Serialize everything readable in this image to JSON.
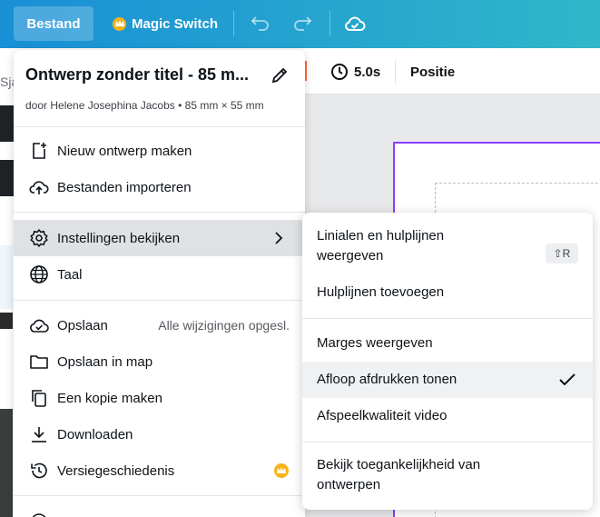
{
  "topbar": {
    "bestand_label": "Bestand",
    "magic_label": "Magic Switch",
    "colors": {
      "gradient_start": "#1a8fd6",
      "gradient_end": "#2fb7c9"
    }
  },
  "toolbar": {
    "timer_label": "5.0s",
    "positie_label": "Positie",
    "search_peek": "Sja"
  },
  "menu": {
    "title": "Ontwerp zonder titel - 85 m...",
    "subtitle": "door Helene Josephina Jacobs • 85 mm × 55 mm",
    "items": [
      {
        "label": "Nieuw ontwerp maken",
        "icon": "plus-document-icon"
      },
      {
        "label": "Bestanden importeren",
        "icon": "cloud-upload-icon"
      },
      {
        "label": "Instellingen bekijken",
        "icon": "gear-icon"
      },
      {
        "label": "Taal",
        "icon": "globe-icon"
      },
      {
        "label": "Opslaan",
        "icon": "cloud-check-icon",
        "status": "Alle wijzigingen opgesl."
      },
      {
        "label": "Opslaan in map",
        "icon": "folder-icon"
      },
      {
        "label": "Een kopie maken",
        "icon": "copy-icon"
      },
      {
        "label": "Downloaden",
        "icon": "download-icon"
      },
      {
        "label": "Versiegeschiedenis",
        "icon": "history-icon"
      }
    ]
  },
  "submenu": {
    "items": [
      {
        "label_line1": "Linialen en hulplijnen",
        "label_line2": "weergeven",
        "shortcut": "⇧R"
      },
      {
        "label": "Hulplijnen toevoegen"
      },
      {
        "label": "Marges weergeven"
      },
      {
        "label": "Afloop afdrukken tonen",
        "checked": true
      },
      {
        "label": "Afspeelkwaliteit video"
      },
      {
        "label_line1": "Bekijk toegankelijkheid van",
        "label_line2": "ontwerpen"
      }
    ]
  }
}
